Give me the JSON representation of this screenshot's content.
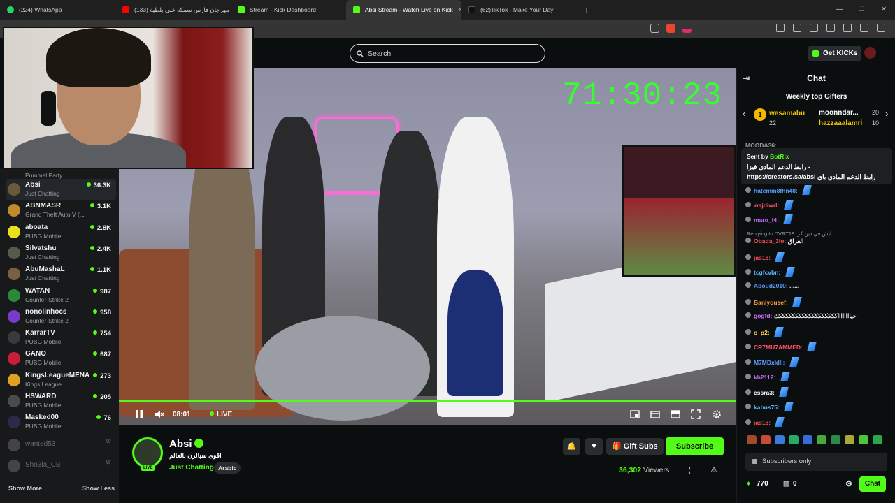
{
  "browser": {
    "tabs": [
      {
        "label": "(224) WhatsApp",
        "color": "#25d366",
        "active": false
      },
      {
        "label": "(133) مهرجان فارس سمكه على بلطية",
        "color": "#ff0000",
        "active": false
      },
      {
        "label": "Stream - Kick Dashboard",
        "color": "#53fc18",
        "active": false
      },
      {
        "label": "Absi Stream - Watch Live on Kick",
        "color": "#53fc18",
        "active": true
      },
      {
        "label": "(62)TikTok - Make Your Day",
        "color": "#111111",
        "active": false
      }
    ],
    "new_tab": "+"
  },
  "topnav": {
    "search_placeholder": "Search",
    "get_kicks": "Get KICKs"
  },
  "sidebar": {
    "top_partial_category": "Pummel Party",
    "channels": [
      {
        "name": "Absi",
        "category": "Just Chatting",
        "viewers": "36.3K",
        "color": "#6b5a3a",
        "active": true
      },
      {
        "name": "ABNMASR",
        "category": "Grand Theft Auto V (...",
        "viewers": "3.1K",
        "color": "#c28a2a"
      },
      {
        "name": "aboata",
        "category": "PUBG Mobile",
        "viewers": "2.8K",
        "color": "#e8e020"
      },
      {
        "name": "Silvatshu",
        "category": "Just Chatting",
        "viewers": "2.4K",
        "color": "#555a4a"
      },
      {
        "name": "AbuMashaL",
        "category": "Just Chatting",
        "viewers": "1.1K",
        "color": "#7a6040"
      },
      {
        "name": "WATAN",
        "category": "Counter-Strike 2",
        "viewers": "987",
        "color": "#2a8a3a"
      },
      {
        "name": "nonolinhocs",
        "category": "Counter-Strike 2",
        "viewers": "958",
        "color": "#7a3ac8"
      },
      {
        "name": "KarrarTV",
        "category": "PUBG Mobile",
        "viewers": "754",
        "color": "#3a3a3a"
      },
      {
        "name": "GANO",
        "category": "PUBG Mobile",
        "viewers": "687",
        "color": "#c81e3a"
      },
      {
        "name": "KingsLeagueMENA",
        "category": "Kings League",
        "viewers": "273",
        "color": "#e0a020"
      },
      {
        "name": "HSWARD",
        "category": "PUBG Mobile",
        "viewers": "205",
        "color": "#4a4a4a"
      },
      {
        "name": "Masked00",
        "category": "PUBG Mobile",
        "viewers": "76",
        "color": "#2a2a4a"
      }
    ],
    "offline": [
      {
        "name": "wanted53"
      },
      {
        "name": "Sho3la_CB"
      }
    ],
    "show_more": "Show More",
    "show_less": "Show Less"
  },
  "player": {
    "timer_overlay": "71:30:23",
    "time": "08:01",
    "live_label": "LIVE"
  },
  "stream": {
    "channel_name": "Absi",
    "title": "اقوى سبالرن بالعالم",
    "category": "Just Chatting",
    "tag": "Arabic",
    "gift_subs": "Gift Subs",
    "subscribe": "Subscribe",
    "viewers": "36,302",
    "viewers_label": "Viewers",
    "avatar_live": "LIVE"
  },
  "chat": {
    "title": "Chat",
    "gifters_title": "Weekly top Gifters",
    "gifters": [
      {
        "rank": "1",
        "name": "wesamabu",
        "count": "22"
      },
      {
        "name": "moonndar...",
        "count": "20"
      },
      {
        "name": "hazzaaalamri",
        "count": "10"
      }
    ],
    "partial_top_user": "MOODA36:",
    "pinned": {
      "sent_by_label": "Sent by",
      "sent_by": "BotRix",
      "message": "رابط الدعم المادي فيزا -",
      "link": "https://creators.sa/absi  رابط الدعم المادي باي..."
    },
    "messages": [
      {
        "user": "hatemm8fhn48:",
        "color": "#5b9dff",
        "text": "",
        "emote": true
      },
      {
        "user": "wajdiwrl:",
        "color": "#ff4f6a",
        "text": "",
        "emote": true
      },
      {
        "user": "maro_f4:",
        "color": "#c86bff",
        "text": "",
        "emote": true
      },
      {
        "user": "Obada_3lo:",
        "color": "#ff4f4f",
        "text": "العراق",
        "emote": false
      },
      {
        "user": "jas18:",
        "color": "#ff4f4f",
        "text": "",
        "emote": true
      },
      {
        "user": "tcgfcvbn:",
        "color": "#5bb6ff",
        "text": "",
        "emote": true
      },
      {
        "user": "Aboud2010:",
        "color": "#5b9dff",
        "text": "......",
        "emote": false
      },
      {
        "user": "Baniyousef:",
        "color": "#ff9e3a",
        "text": "",
        "emote": true
      },
      {
        "user": "gogfd:",
        "color": "#d06bff",
        "text": "حيااااااااككككككككككككككككككك",
        "emote": false
      },
      {
        "user": "o_p2:",
        "color": "#ffd23a",
        "text": "",
        "emote": true
      },
      {
        "user": "CR7MU7AMMED:",
        "color": "#ff4f6a",
        "text": "",
        "emote": true
      },
      {
        "user": "M7MDxklll:",
        "color": "#5b9dff",
        "text": "",
        "emote": true
      },
      {
        "user": "kh2112:",
        "color": "#c86bff",
        "text": "",
        "emote": true
      },
      {
        "user": "essra3:",
        "color": "#ffffff",
        "text": "",
        "emote": true
      },
      {
        "user": "kabus75:",
        "color": "#5bb6ff",
        "text": "",
        "emote": true
      },
      {
        "user": "jas18:",
        "color": "#ff4f4f",
        "text": "",
        "emote": true
      }
    ],
    "reply_note": "Replying to DVRT18: ايش في دين كز",
    "subscribers_only": "Subscribers only",
    "kicks_count": "770",
    "subs_count": "0",
    "chat_button": "Chat"
  },
  "colors": {
    "accent": "#53fc18",
    "bg": "#0b0e0f",
    "sidebar_bg": "#17191b"
  }
}
